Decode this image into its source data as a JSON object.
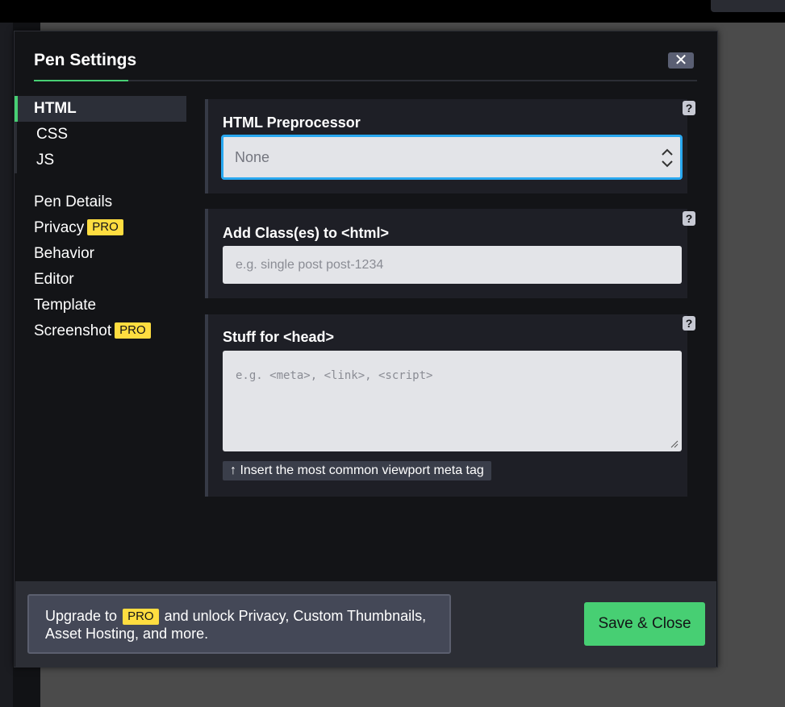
{
  "modal": {
    "title": "Pen Settings",
    "close_label": "✕"
  },
  "sidebar": {
    "languages": [
      {
        "label": "HTML",
        "active": true
      },
      {
        "label": "CSS",
        "active": false
      },
      {
        "label": "JS",
        "active": false
      }
    ],
    "items": [
      {
        "label": "Pen Details"
      },
      {
        "label": "Privacy",
        "badge": "PRO"
      },
      {
        "label": "Behavior"
      },
      {
        "label": "Editor"
      },
      {
        "label": "Template"
      },
      {
        "label": "Screenshot",
        "badge": "PRO"
      }
    ]
  },
  "preprocessor": {
    "label": "HTML Preprocessor",
    "value": "None",
    "help": "?"
  },
  "html_class": {
    "label": "Add Class(es) to <html>",
    "placeholder": "e.g. single post post-1234",
    "help": "?"
  },
  "head": {
    "label": "Stuff for <head>",
    "placeholder": "e.g. <meta>, <link>, <script>",
    "help": "?",
    "insert_button": "↑ Insert the most common viewport meta tag"
  },
  "footer": {
    "upgrade_prefix": "Upgrade to",
    "upgrade_badge": "PRO",
    "upgrade_suffix": "and unlock Privacy, Custom Thumbnails, Asset Hosting, and more.",
    "save_label": "Save & Close"
  },
  "colors": {
    "accent_green": "#47cf73",
    "pro_yellow": "#ffdd40",
    "focus_blue": "#29a8f0"
  }
}
